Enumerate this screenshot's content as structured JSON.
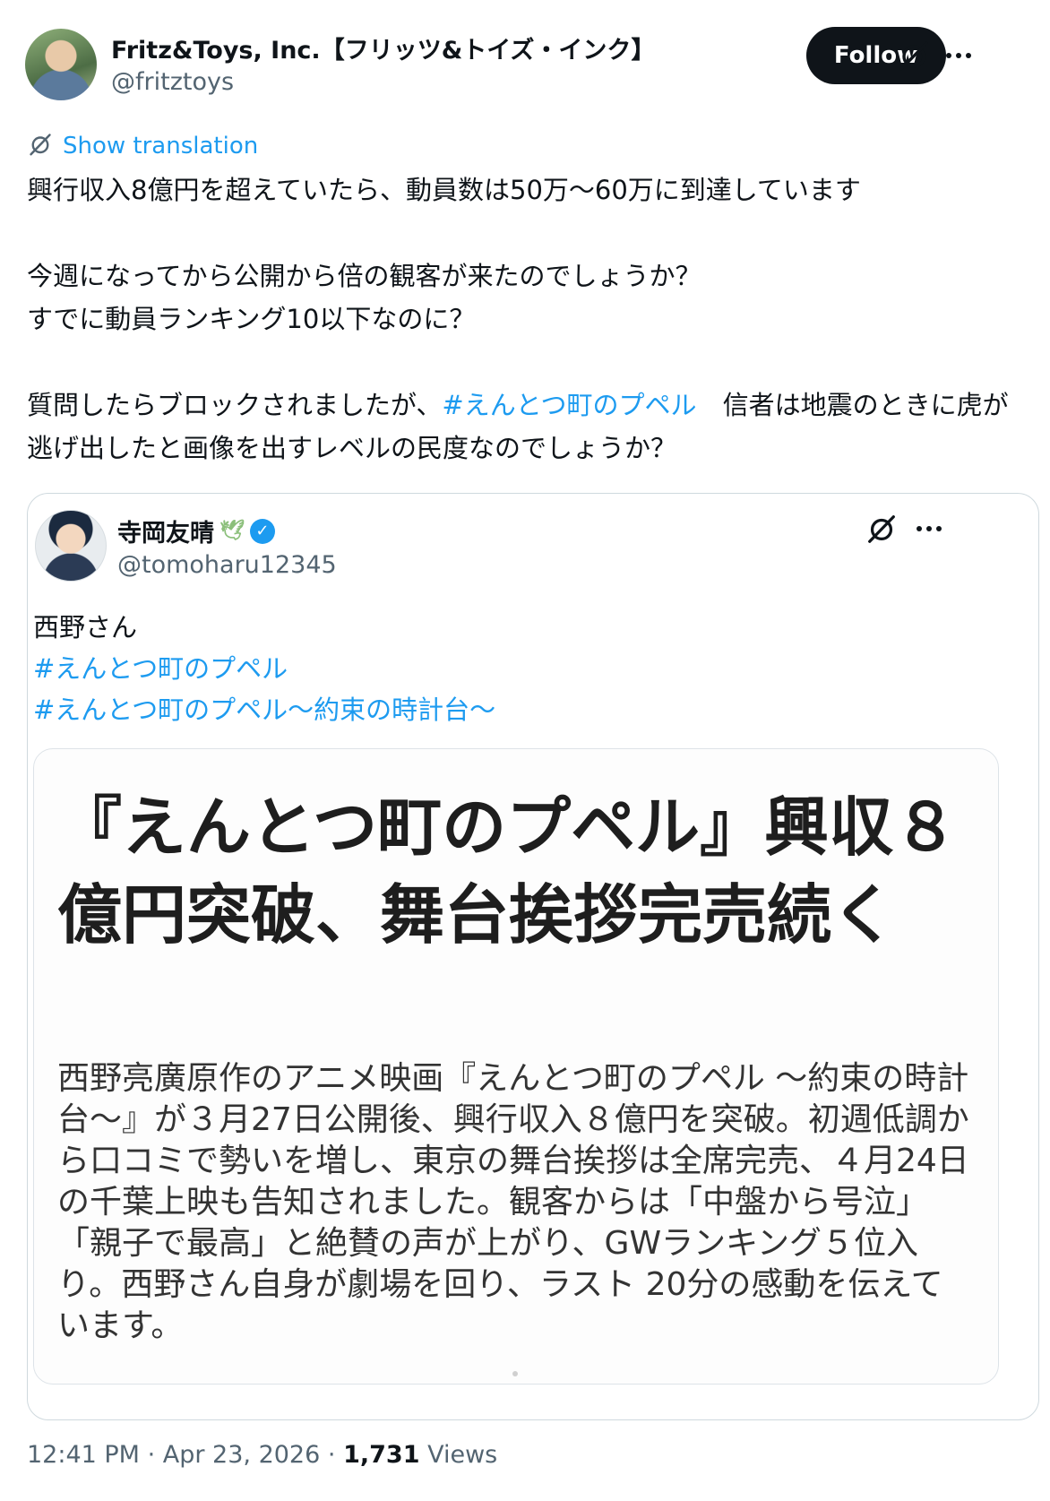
{
  "author": {
    "name": "Fritz&Toys, Inc.【フリッツ&トイズ・インク】",
    "handle": "@fritztoys",
    "avatar": "avatar"
  },
  "actions": {
    "follow_label": "Follow",
    "grok_icon": "grok-icon",
    "more_icon": "more-icon"
  },
  "translation": {
    "icon": "translate-icon",
    "label": "Show translation"
  },
  "tweet": {
    "line1": "興行収入8億円を超えていたら、動員数は50万〜60万に到達しています",
    "line2": "今週になってから公開から倍の観客が来たのでしょうか？",
    "line3": "すでに動員ランキング10以下なのに？",
    "line4_before": "質問したらブロックされましたが、",
    "line4_hashtag": "#えんとつ町のプペル",
    "line4_after": "　信者は地震のときに虎が逃げ出したと画像を出すレベルの民度なのでしょうか？"
  },
  "quote": {
    "name": "寺岡友晴",
    "emoji": "🕊",
    "handle": "@tomoharu12345",
    "text": "西野さん",
    "hashtag1": "#えんとつ町のプペル",
    "hashtag2": "#えんとつ町のプペル〜約束の時計台〜",
    "image": {
      "headline": "『えんとつ町のプペル』興収８億円突破、舞台挨拶完売続く",
      "body": "西野亮廣原作のアニメ映画『えんとつ町のプペル ～約束の時計台～』が３月27日公開後、興行収入８億円を突破。初週低調から口コミで勢いを増し、東京の舞台挨拶は全席完売、４月24日の千葉上映も告知されました。観客からは「中盤から号泣」「親子で最高」と絶賛の声が上がり、GWランキング５位入り。西野さん自身が劇場を回り、ラスト 20分の感動を伝えています。"
    }
  },
  "meta": {
    "time": "12:41 PM",
    "date": "Apr 23, 2026",
    "separator": "·",
    "views_count": "1,731",
    "views_label": "Views"
  },
  "colors": {
    "accent": "#1d9bf0",
    "text": "#0f1419",
    "secondary": "#536471",
    "border": "#cfd9de"
  }
}
